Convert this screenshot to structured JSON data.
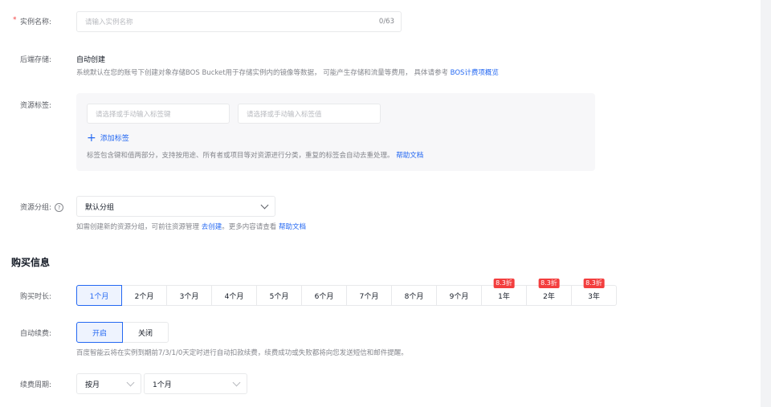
{
  "form": {
    "name_label": "实例名称:",
    "name_placeholder": "请输入实例名称",
    "name_counter": "0/63",
    "storage_label": "后端存储:",
    "storage_value": "自动创建",
    "storage_hint": "系统默认在您的账号下创建对象存储BOS Bucket用于存储实例内的镜像等数据， 可能产生存储和流量等费用， 具体请参考 ",
    "storage_link": "BOS计费项概览",
    "tags_label": "资源标签:",
    "tag_key_placeholder": "请选择或手动输入标签键",
    "tag_value_placeholder": "请选择或手动输入标签值",
    "add_tag_label": "添加标签",
    "tags_hint": "标签包含键和值两部分，支持按用途、所有者或项目等对资源进行分类，重复的标签会自动去重处理。 ",
    "tags_help_link": "帮助文档",
    "group_label": "资源分组:",
    "group_selected": "默认分组",
    "group_hint_pre": "如需创建新的资源分组，可前往资源管理 ",
    "group_create_link": "去创建",
    "group_hint_mid": "。更多内容请查看 ",
    "group_help_link": "帮助文档"
  },
  "purchase": {
    "title": "购买信息",
    "duration_label": "购买时长:",
    "durations": [
      {
        "label": "1个月",
        "badge": ""
      },
      {
        "label": "2个月",
        "badge": ""
      },
      {
        "label": "3个月",
        "badge": ""
      },
      {
        "label": "4个月",
        "badge": ""
      },
      {
        "label": "5个月",
        "badge": ""
      },
      {
        "label": "6个月",
        "badge": ""
      },
      {
        "label": "7个月",
        "badge": ""
      },
      {
        "label": "8个月",
        "badge": ""
      },
      {
        "label": "9个月",
        "badge": ""
      },
      {
        "label": "1年",
        "badge": "8.3折"
      },
      {
        "label": "2年",
        "badge": "8.3折"
      },
      {
        "label": "3年",
        "badge": "8.3折"
      }
    ],
    "autorenew_label": "自动续费:",
    "autorenew_on": "开启",
    "autorenew_off": "关闭",
    "autorenew_hint": "百度智能云将在实例到期前7/3/1/0天定时进行自动扣款续费，续费成功或失败都将向您发送短信和邮件提醒。",
    "renew_period_label": "续费周期:",
    "renew_unit": "按月",
    "renew_length": "1个月"
  },
  "colors": {
    "accent": "#2468f2",
    "badge": "#f33e3e"
  }
}
